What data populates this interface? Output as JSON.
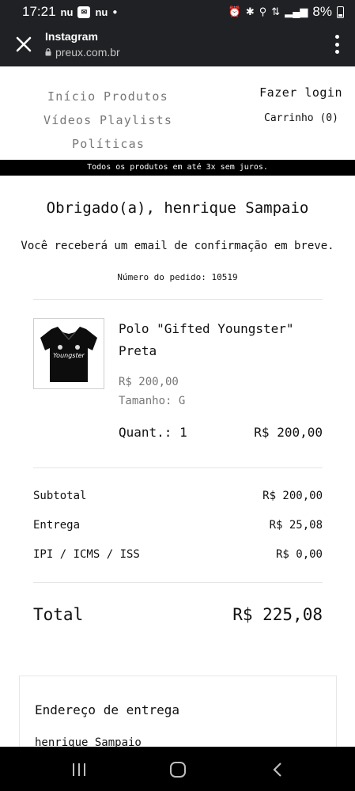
{
  "status_bar": {
    "time": "17:21",
    "app_icons": [
      "nu",
      "nu"
    ],
    "battery": "8%"
  },
  "browser": {
    "app_name": "Instagram",
    "url": "preux.com.br"
  },
  "nav": {
    "links": [
      "Início",
      "Produtos",
      "Vídeos",
      "Playlists",
      "Políticas"
    ],
    "login": "Fazer login",
    "cart": "Carrinho (0)"
  },
  "banner": "Todos os produtos em até 3x sem juros.",
  "order": {
    "heading": "Obrigado(a), henrique Sampaio",
    "confirmation": "Você receberá um email de confirmação em breve.",
    "order_number": "Número do pedido: 10519"
  },
  "product": {
    "name": "Polo \"Gifted Youngster\" Preta",
    "price": "R$ 200,00",
    "size": "Tamanho: G",
    "quantity": "Quant.: 1",
    "line_total": "R$ 200,00",
    "image_text": "Youngster"
  },
  "summary": {
    "subtotal_label": "Subtotal",
    "subtotal_value": "R$ 200,00",
    "shipping_label": "Entrega",
    "shipping_value": "R$ 25,08",
    "tax_label": "IPI / ICMS / ISS",
    "tax_value": "R$ 0,00",
    "total_label": "Total",
    "total_value": "R$ 225,08"
  },
  "address": {
    "title": "Endereço de entrega",
    "name": "henrique Sampaio"
  }
}
